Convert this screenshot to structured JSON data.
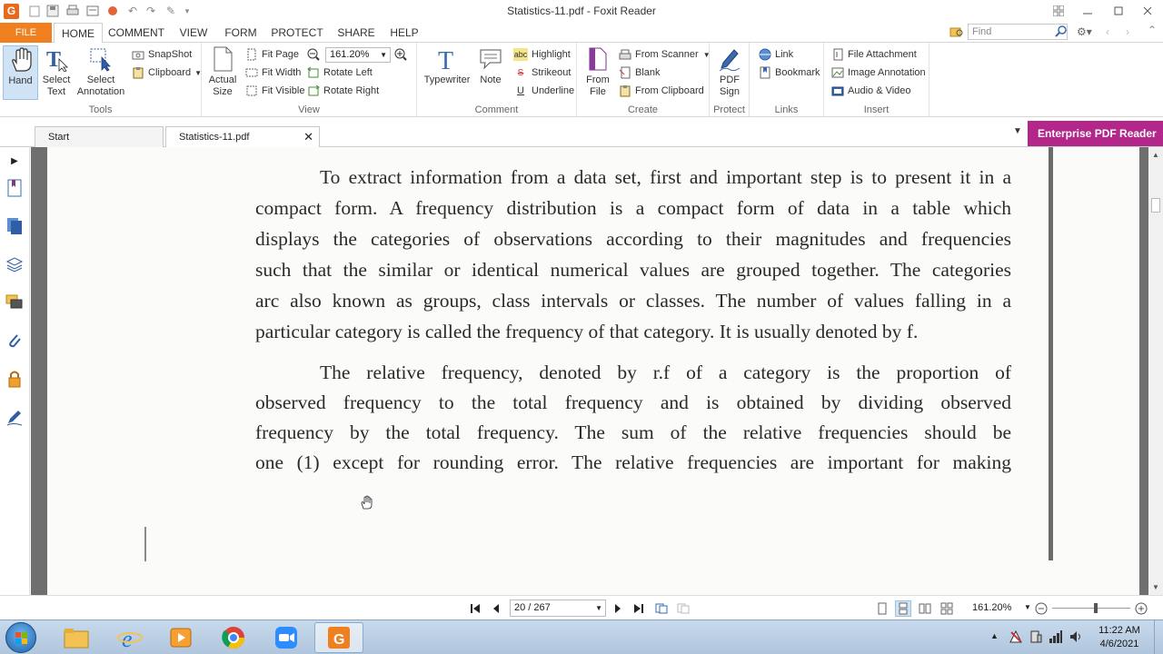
{
  "window": {
    "title": "Statistics-11.pdf - Foxit Reader"
  },
  "ribbon_tabs": [
    "FILE",
    "HOME",
    "COMMENT",
    "VIEW",
    "FORM",
    "PROTECT",
    "SHARE",
    "HELP"
  ],
  "find": {
    "placeholder": "Find"
  },
  "groups": {
    "tools": {
      "label": "Tools",
      "hand": "Hand",
      "select_text": "Select Text",
      "select_annotation": "Select Annotation",
      "snapshot": "SnapShot",
      "clipboard": "Clipboard"
    },
    "view": {
      "label": "View",
      "actual_size": "Actual Size",
      "fit_page": "Fit Page",
      "fit_width": "Fit Width",
      "fit_visible": "Fit Visible",
      "zoom_value": "161.20%",
      "rotate_left": "Rotate Left",
      "rotate_right": "Rotate Right"
    },
    "comment": {
      "label": "Comment",
      "typewriter": "Typewriter",
      "note": "Note",
      "highlight": "Highlight",
      "strikeout": "Strikeout",
      "underline": "Underline"
    },
    "create": {
      "label": "Create",
      "from_file": "From File",
      "from_scanner": "From Scanner",
      "blank": "Blank",
      "from_clipboard": "From Clipboard"
    },
    "protect": {
      "label": "Protect",
      "pdf_sign": "PDF Sign"
    },
    "links": {
      "label": "Links",
      "link": "Link",
      "bookmark": "Bookmark"
    },
    "insert": {
      "label": "Insert",
      "file_attachment": "File Attachment",
      "image_annotation": "Image Annotation",
      "audio_video": "Audio & Video"
    }
  },
  "doc_tabs": {
    "start": "Start",
    "current": "Statistics-11.pdf"
  },
  "enterprise": "Enterprise PDF Reader",
  "document": {
    "paragraph1": [
      "To extract information from a data set, first and important step is to present it in a",
      "compact form. A frequency distribution is a compact form of data in a table which",
      "displays the categories of observations according to their magnitudes and frequencies",
      "such that the similar or identical numerical values are grouped together. The categories",
      "arc also known as groups, class intervals or classes. The number of values falling in a",
      "particular category is called the frequency of that category. It is usually denoted by f."
    ],
    "paragraph2": [
      "The relative frequency, denoted by r.f  of a category is the proportion of",
      "observed frequency to the total frequency and is obtained by dividing observed",
      "frequency by the total frequency. The sum of the relative frequencies should be",
      "one (1) except for rounding error. The relative frequencies are important for making"
    ]
  },
  "status": {
    "page": "20 / 267",
    "zoom": "161.20%"
  },
  "clock": {
    "time": "11:22 AM",
    "date": "4/6/2021"
  },
  "colors": {
    "accent": "#f07f1f",
    "enterprise": "#b3278b",
    "doc_bg": "#6f6f6f"
  }
}
